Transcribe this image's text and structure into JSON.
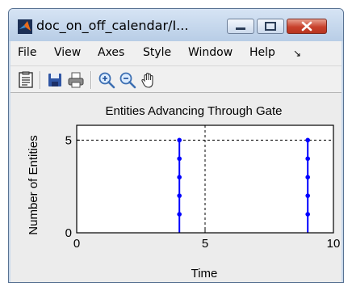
{
  "window": {
    "title": "doc_on_off_calendar/I..."
  },
  "menu": {
    "items": [
      "File",
      "View",
      "Axes",
      "Style",
      "Window",
      "Help",
      "↘"
    ]
  },
  "toolbar": {
    "icons": [
      "properties-icon",
      "save-icon",
      "print-icon",
      "zoom-in-icon",
      "zoom-out-icon",
      "pan-icon"
    ]
  },
  "chart_data": {
    "type": "scatter",
    "title": "Entities Advancing Through Gate",
    "xlabel": "Time",
    "ylabel": "Number of Entities",
    "xlim": [
      0,
      10
    ],
    "ylim": [
      0,
      5.8
    ],
    "xticks": [
      "0",
      "5",
      "10"
    ],
    "yticks": [
      "0",
      "5"
    ],
    "grid": true,
    "color": "#0000ff",
    "series": [
      {
        "x": [
          4,
          4,
          4,
          4,
          4,
          9,
          9,
          9,
          9,
          9
        ],
        "y": [
          1,
          2,
          3,
          4,
          5,
          1,
          2,
          3,
          4,
          5
        ]
      }
    ],
    "stems": [
      {
        "x": 4,
        "y0": 0,
        "y1": 5
      },
      {
        "x": 9,
        "y0": 0,
        "y1": 5
      }
    ]
  }
}
